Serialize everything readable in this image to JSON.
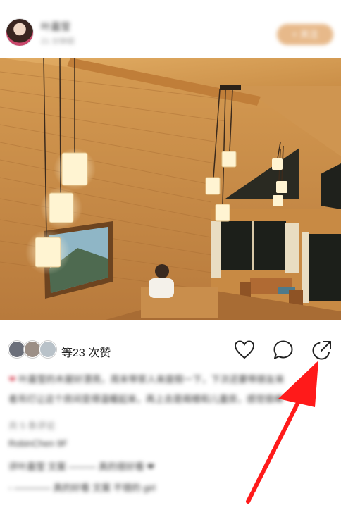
{
  "header": {
    "username": "叶嘉莹",
    "subtitle": "21 分钟前",
    "follow_label": "+ 关注"
  },
  "likes": {
    "prefix": "等",
    "count": "23",
    "suffix": "次赞"
  },
  "caption": {
    "line1": "叶嘉莹的木屋好漂亮，周末带家人来度假一下，下次还要带朋友来",
    "line2": "者吊灯让这个房间变得温暖起来，再上去是阁楼和儿童房，感觉很棒",
    "line3": "共 5 条评论",
    "line4": "RobinChen 9F",
    "line5": "评叶嘉莹 文案 ——— 真的很好看 ❤",
    "line6": "- ———— 真的好看 文案 不错的 girl"
  },
  "icons": {
    "heart": "heart-icon",
    "comment": "comment-icon",
    "share": "share-icon",
    "annotation": "red-arrow"
  },
  "colors": {
    "follow": "#e7b98a",
    "wood": "#d9a25a",
    "annotation": "#ff1a1a"
  }
}
